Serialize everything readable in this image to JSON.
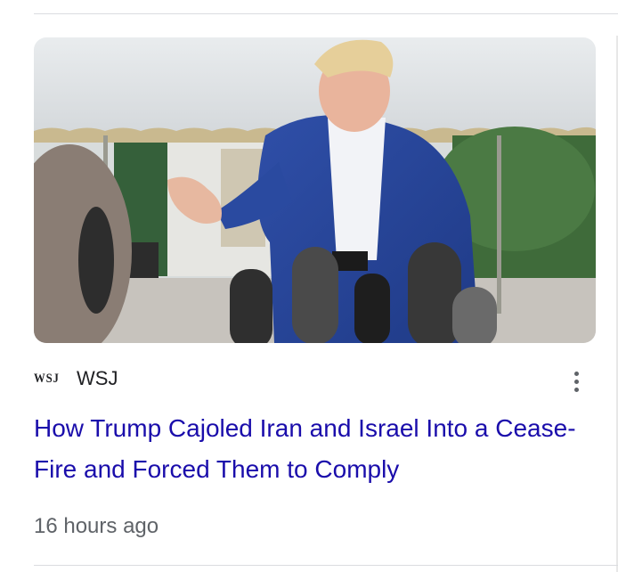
{
  "article": {
    "source_logo_text": "WSJ",
    "source_name": "WSJ",
    "headline": "How Trump Cajoled Iran and Israel Into a Cease-Fire and Forced Them to Comply",
    "timestamp": "16 hours ago",
    "more_icon": "more-vert-icon"
  },
  "colors": {
    "headline_link": "#1a0dab",
    "meta_text": "#5f6368",
    "divider": "#dadce0"
  }
}
